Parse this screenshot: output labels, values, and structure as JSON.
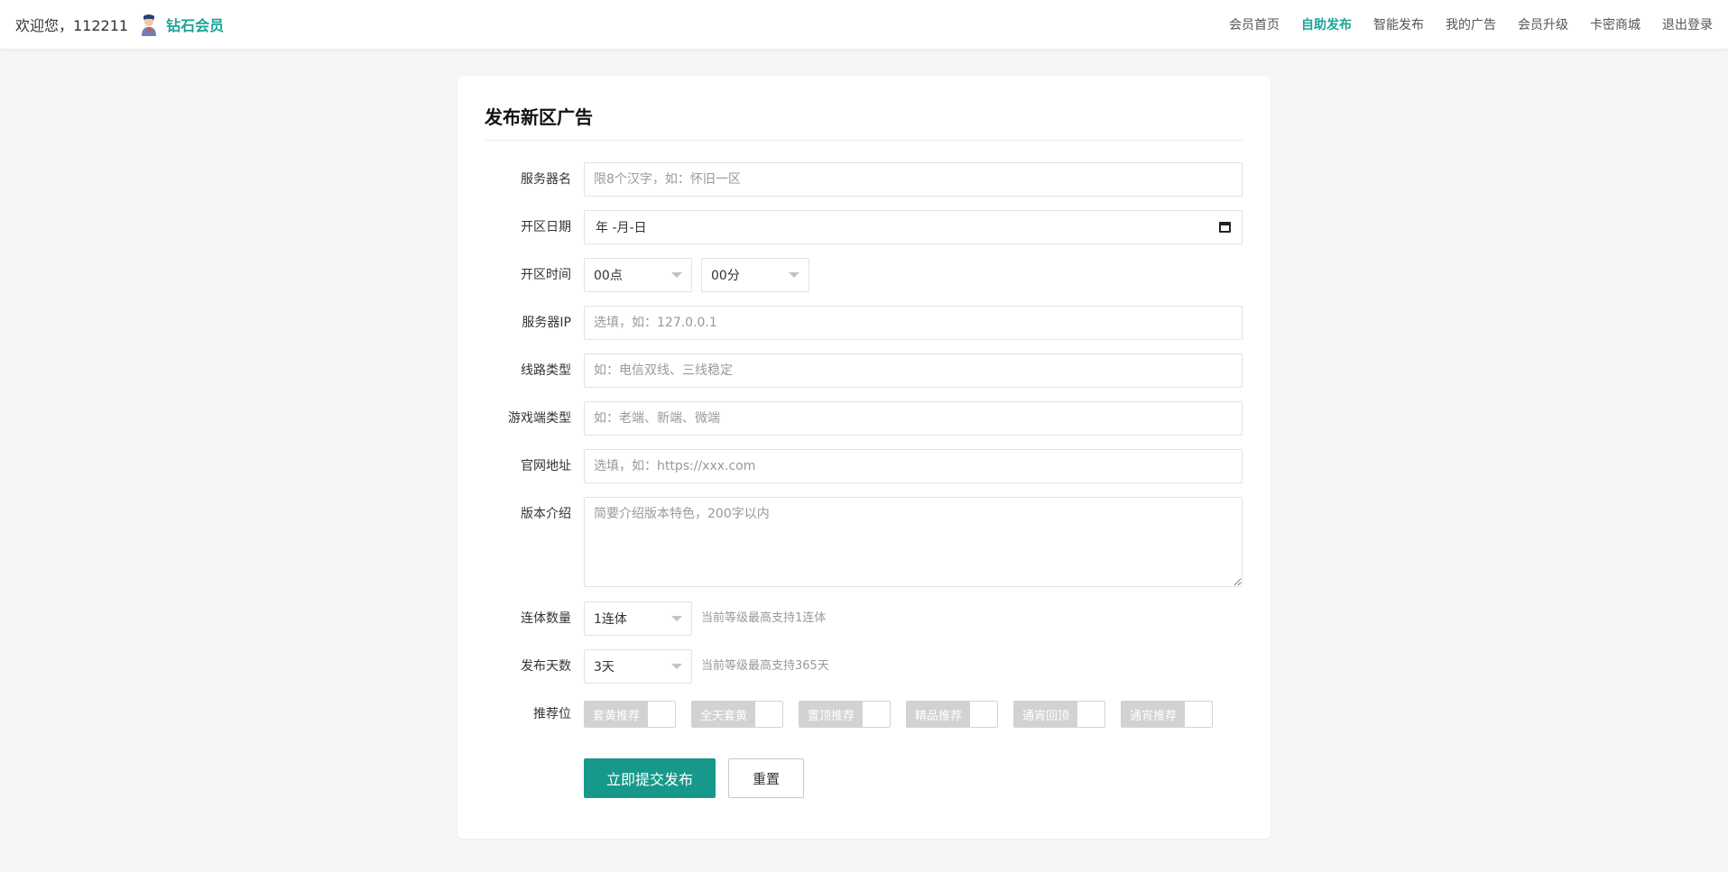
{
  "header": {
    "welcome": "欢迎您，112211",
    "member_level": "钻石会员",
    "avatar_icon": "person-avatar-icon",
    "accent_color": "#1aa394",
    "nav": [
      {
        "label": "会员首页",
        "active": false
      },
      {
        "label": "自助发布",
        "active": true
      },
      {
        "label": "智能发布",
        "active": false
      },
      {
        "label": "我的广告",
        "active": false
      },
      {
        "label": "会员升级",
        "active": false
      },
      {
        "label": "卡密商城",
        "active": false
      },
      {
        "label": "退出登录",
        "active": false
      }
    ]
  },
  "form": {
    "title": "发布新区广告",
    "server_name": {
      "label": "服务器名",
      "placeholder": "限8个汉字，如：怀旧一区"
    },
    "open_date": {
      "label": "开区日期",
      "value": "年 -月-日",
      "icon": "calendar-icon"
    },
    "open_time": {
      "label": "开区时间",
      "hour": "00点",
      "minute": "00分"
    },
    "server_ip": {
      "label": "服务器IP",
      "placeholder": "选填，如：127.0.0.1"
    },
    "line_type": {
      "label": "线路类型",
      "placeholder": "如：电信双线、三线稳定"
    },
    "client_type": {
      "label": "游戏端类型",
      "placeholder": "如：老端、新端、微端"
    },
    "website": {
      "label": "官网地址",
      "placeholder": "选填，如：https://xxx.com"
    },
    "version_intro": {
      "label": "版本介绍",
      "placeholder": "简要介绍版本特色，200字以内"
    },
    "combo_count": {
      "label": "连体数量",
      "value": "1连体",
      "hint": "当前等级最高支持1连体"
    },
    "publish_days": {
      "label": "发布天数",
      "value": "3天",
      "hint": "当前等级最高支持365天"
    },
    "recommend": {
      "label": "推荐位",
      "options": [
        "套黄推荐",
        "全天套黄",
        "置顶推荐",
        "精品推荐",
        "通宵回顶",
        "通宵推荐"
      ]
    },
    "submit_label": "立即提交发布",
    "reset_label": "重置",
    "button_color": "#16998a"
  }
}
